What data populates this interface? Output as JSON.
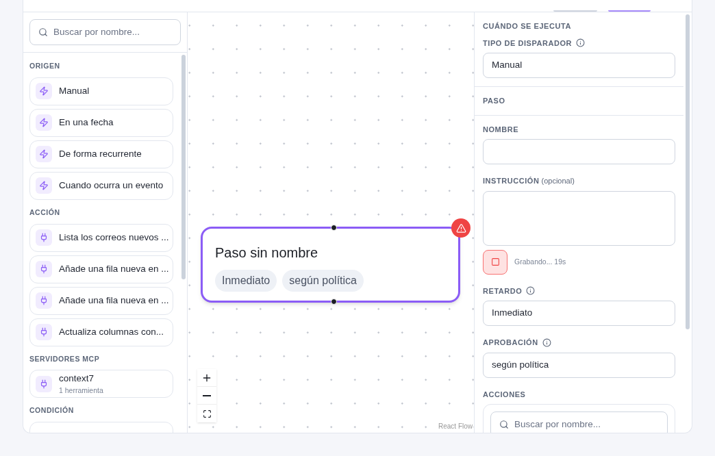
{
  "sidebar": {
    "search": {
      "placeholder": "Buscar por nombre..."
    },
    "sections": [
      {
        "title": "ORIGEN",
        "items": [
          {
            "kind": "trigger",
            "label": "Manual"
          },
          {
            "kind": "trigger",
            "label": "En una fecha"
          },
          {
            "kind": "trigger",
            "label": "De forma recurrente"
          },
          {
            "kind": "trigger",
            "label": "Cuando ocurra un evento"
          }
        ]
      },
      {
        "title": "ACCIÓN",
        "items": [
          {
            "kind": "plug",
            "label": "Lista los correos nuevos ..."
          },
          {
            "kind": "plug",
            "label": "Añade una fila nueva en ..."
          },
          {
            "kind": "plug",
            "label": "Añade una fila nueva en ..."
          },
          {
            "kind": "plug",
            "label": "Actualiza columnas con..."
          }
        ]
      },
      {
        "title": "SERVIDORES MCP",
        "items": [
          {
            "kind": "plug",
            "label": "context7",
            "sublabel": "1 herramienta"
          }
        ]
      },
      {
        "title": "CONDICIÓN"
      }
    ]
  },
  "canvas": {
    "node": {
      "title": "Paso sin nombre",
      "warning": true,
      "tags": [
        "Inmediato",
        "según política"
      ]
    },
    "attribution": "React Flow"
  },
  "inspector": {
    "section_title": "CUÁNDO SE EJECUTA",
    "trigger": {
      "label": "TIPO DE DISPARADOR",
      "value": "Manual"
    },
    "step_title": "PASO",
    "name": {
      "label": "NOMBRE"
    },
    "instruction": {
      "label": "INSTRUCCIÓN",
      "hint": "(opcional)"
    },
    "recording": {
      "on": true,
      "status": "Grabando... 19s"
    },
    "delay": {
      "label": "RETARDO",
      "value": "Inmediato"
    },
    "approval": {
      "label": "APROBACIÓN",
      "value": "según política"
    },
    "actions": {
      "label": "ACCIONES",
      "search": {
        "placeholder": "Buscar por nombre..."
      }
    }
  }
}
